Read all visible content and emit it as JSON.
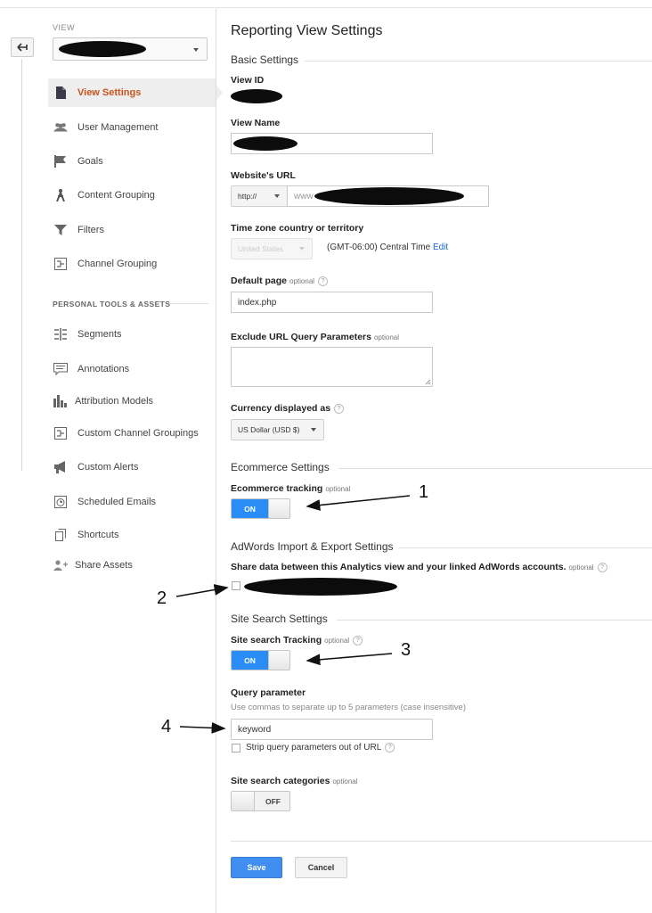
{
  "sidebar": {
    "view_label": "VIEW",
    "section_personal": "PERSONAL TOOLS & ASSETS",
    "items": [
      {
        "label": "View Settings",
        "icon": "document-icon"
      },
      {
        "label": "User Management",
        "icon": "users-icon"
      },
      {
        "label": "Goals",
        "icon": "flag-icon"
      },
      {
        "label": "Content Grouping",
        "icon": "person-walk-icon"
      },
      {
        "label": "Filters",
        "icon": "funnel-icon"
      },
      {
        "label": "Channel Grouping",
        "icon": "channel-icon"
      },
      {
        "label": "Segments",
        "icon": "segments-icon"
      },
      {
        "label": "Annotations",
        "icon": "speech-bubble-icon"
      },
      {
        "label": "Attribution Models",
        "icon": "bar-chart-icon"
      },
      {
        "label": "Custom Channel Groupings",
        "icon": "channel-icon"
      },
      {
        "label": "Custom Alerts",
        "icon": "megaphone-icon"
      },
      {
        "label": "Scheduled Emails",
        "icon": "alarm-clock-icon"
      },
      {
        "label": "Shortcuts",
        "icon": "copy-icon"
      },
      {
        "label": "Share Assets",
        "icon": "add-user-icon"
      }
    ]
  },
  "main": {
    "title": "Reporting View Settings",
    "basic_settings": "Basic Settings",
    "view_id_label": "View ID",
    "view_name_label": "View Name",
    "website_url_label": "Website's URL",
    "protocol": "http://",
    "url_prefix": "www",
    "timezone_label": "Time zone country or territory",
    "timezone_country": "United States",
    "timezone_value": "(GMT-06:00) Central Time",
    "edit_link": "Edit",
    "default_page_label": "Default page",
    "optional": "optional",
    "default_page_value": "index.php",
    "exclude_label": "Exclude URL Query Parameters",
    "currency_label": "Currency displayed as",
    "currency_value": "US Dollar (USD $)",
    "ecommerce_settings": "Ecommerce Settings",
    "ecommerce_tracking_label": "Ecommerce tracking",
    "toggle_on": "ON",
    "toggle_off": "OFF",
    "adwords_settings": "AdWords Import & Export Settings",
    "share_data_label": "Share data between this Analytics view and your linked AdWords accounts.",
    "site_search_settings": "Site Search Settings",
    "site_search_tracking_label": "Site search Tracking",
    "query_param_label": "Query parameter",
    "query_param_hint": "Use commas to separate up to 5 parameters (case insensitive)",
    "query_param_value": "keyword",
    "strip_label": "Strip query parameters out of URL",
    "site_search_categories_label": "Site search categories",
    "save": "Save",
    "cancel": "Cancel",
    "help_glyph": "?"
  },
  "annotations": {
    "n1": "1",
    "n2": "2",
    "n3": "3",
    "n4": "4"
  },
  "colors": {
    "accent": "#c8531d",
    "toggle_on": "#2a8df5",
    "link": "#1a66cc"
  }
}
